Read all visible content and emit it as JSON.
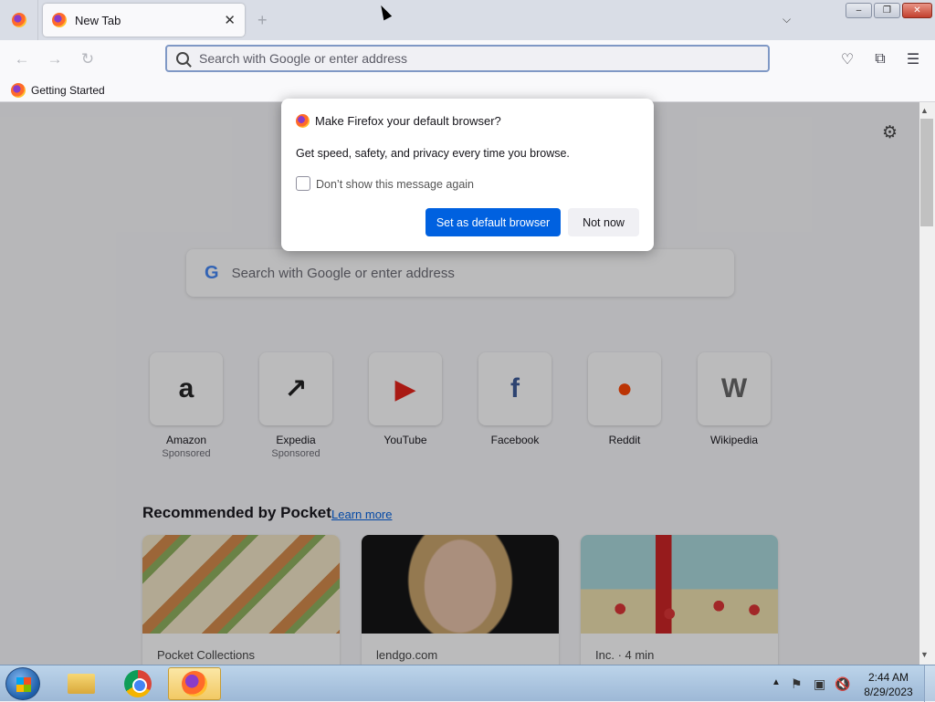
{
  "window": {
    "tab_title": "New Tab",
    "tab_close": "✕",
    "new_tab": "+",
    "tab_list": "⌵",
    "min": "–",
    "max": "❐",
    "close": "✕"
  },
  "navbar": {
    "back": "←",
    "forward": "→",
    "reload": "↻",
    "url_placeholder": "Search with Google or enter address",
    "pocket_icon": "pocket-icon",
    "extensions_icon": "puzzle-icon",
    "menu_icon": "hamburger-menu-icon",
    "pocket": "♡",
    "extensions": "⧉",
    "menu": "☰"
  },
  "bookmarks": {
    "items": [
      {
        "label": "Getting Started"
      }
    ]
  },
  "newtab": {
    "gear": "⚙",
    "search_placeholder": "Search with Google or enter address",
    "google_letter": "G",
    "top_sites": [
      {
        "name": "Amazon",
        "sponsored": "Sponsored",
        "icon": "amazon-logo",
        "glyph": "a",
        "color": "#222222"
      },
      {
        "name": "Expedia",
        "sponsored": "Sponsored",
        "icon": "expedia-logo",
        "glyph": "↗",
        "color": "#1e1e1e"
      },
      {
        "name": "YouTube",
        "sponsored": "",
        "icon": "youtube-logo",
        "glyph": "▶",
        "color": "#e62117"
      },
      {
        "name": "Facebook",
        "sponsored": "",
        "icon": "facebook-logo",
        "glyph": "f",
        "color": "#3b5998"
      },
      {
        "name": "Reddit",
        "sponsored": "",
        "icon": "reddit-logo",
        "glyph": "●",
        "color": "#ff4500"
      },
      {
        "name": "Wikipedia",
        "sponsored": "",
        "icon": "wikipedia-logo",
        "glyph": "W",
        "color": "#666666"
      }
    ],
    "pocket": {
      "title": "Recommended by Pocket",
      "learn_more": "Learn more",
      "cards": [
        {
          "source": "Pocket Collections"
        },
        {
          "source": "lendgo.com"
        },
        {
          "source": "Inc. · 4 min"
        }
      ]
    }
  },
  "dialog": {
    "title": "Make Firefox your default browser?",
    "message": "Get speed, safety, and privacy every time you browse.",
    "checkbox_label": "Don’t show this message again",
    "primary_button": "Set as default browser",
    "secondary_button": "Not now"
  },
  "taskbar": {
    "tray_arrow": "▲",
    "time": "2:44 AM",
    "date": "8/29/2023",
    "tray_icons": [
      {
        "name": "action-center-flag-icon",
        "glyph": "⚑"
      },
      {
        "name": "network-icon",
        "glyph": "▣"
      },
      {
        "name": "volume-muted-icon",
        "glyph": "🔇"
      }
    ]
  }
}
